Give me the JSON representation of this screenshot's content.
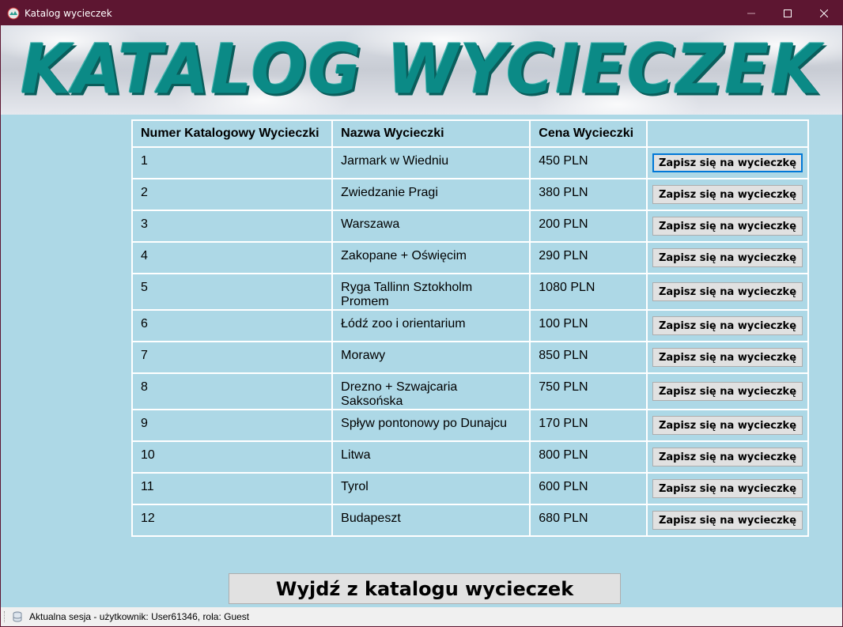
{
  "window": {
    "title": "Katalog wycieczek"
  },
  "banner": {
    "text": "KATALOG WYCIECZEK"
  },
  "table": {
    "headers": [
      "Numer Katalogowy Wycieczki",
      "Nazwa Wycieczki",
      "Cena Wycieczki",
      ""
    ],
    "rows": [
      {
        "num": "1",
        "name": "Jarmark w Wiedniu",
        "price": "450 PLN",
        "button": "Zapisz się na wycieczkę"
      },
      {
        "num": "2",
        "name": "Zwiedzanie Pragi",
        "price": "380 PLN",
        "button": "Zapisz się na wycieczkę"
      },
      {
        "num": "3",
        "name": "Warszawa",
        "price": "200 PLN",
        "button": "Zapisz się na wycieczkę"
      },
      {
        "num": "4",
        "name": "Zakopane + Oświęcim",
        "price": "290 PLN",
        "button": "Zapisz się na wycieczkę"
      },
      {
        "num": "5",
        "name": "Ryga Tallinn Sztokholm Promem",
        "price": "1080 PLN",
        "button": "Zapisz się na wycieczkę"
      },
      {
        "num": "6",
        "name": "Łódź zoo i orientarium",
        "price": "100 PLN",
        "button": "Zapisz się na wycieczkę"
      },
      {
        "num": "7",
        "name": "Morawy",
        "price": "850 PLN",
        "button": "Zapisz się na wycieczkę"
      },
      {
        "num": "8",
        "name": "Drezno + Szwajcaria Saksońska",
        "price": "750 PLN",
        "button": "Zapisz się na wycieczkę"
      },
      {
        "num": "9",
        "name": "Spływ pontonowy po Dunajcu",
        "price": "170 PLN",
        "button": "Zapisz się na wycieczkę"
      },
      {
        "num": "10",
        "name": "Litwa",
        "price": "800 PLN",
        "button": "Zapisz się na wycieczkę"
      },
      {
        "num": "11",
        "name": "Tyrol",
        "price": "600 PLN",
        "button": "Zapisz się na wycieczkę"
      },
      {
        "num": "12",
        "name": "Budapeszt",
        "price": "680 PLN",
        "button": "Zapisz się na wycieczkę"
      }
    ]
  },
  "exit_button": "Wyjdź z katalogu wycieczek",
  "status": {
    "text": "Aktualna sesja - użytkownik: User61346, rola: Guest"
  },
  "colors": {
    "titlebar": "#5d1631",
    "background": "#add8e6",
    "banner_text": "#0b8a86",
    "focus": "#0078d7"
  }
}
